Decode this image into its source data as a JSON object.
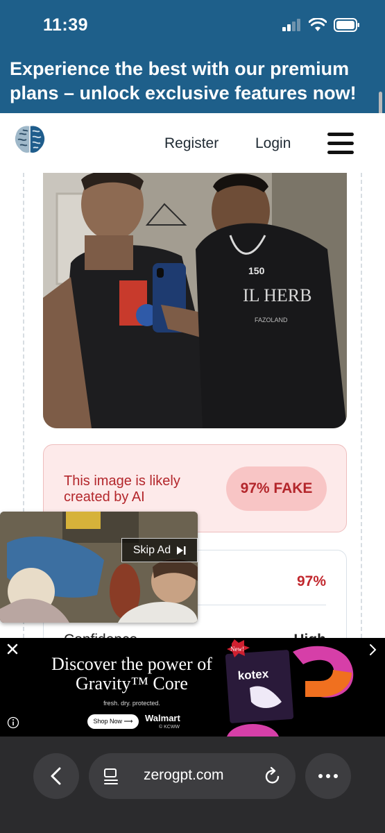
{
  "status_bar": {
    "time": "11:39"
  },
  "promo_banner": {
    "text": "Experience the best with our premium plans – unlock exclusive features now!"
  },
  "header": {
    "logo": "brain-logo-icon",
    "register": "Register",
    "login": "Login",
    "menu": "hamburger-menu-icon"
  },
  "result": {
    "message": "This image is likely created by AI",
    "badge": "97% FAKE",
    "detail_percent": "97%",
    "confidence_label": "Confidence",
    "confidence_value": "High"
  },
  "video_ad": {
    "skip_label": "Skip Ad"
  },
  "banner_ad": {
    "headline": "Discover the power of Gravity™ Core",
    "tagline": "fresh. dry. protected.",
    "button": "Shop Now ⟶",
    "retailer": "Walmart",
    "station": "© KCWW",
    "badge": "New!",
    "brand": "kotex"
  },
  "browser": {
    "url": "zerogpt.com"
  },
  "colors": {
    "banner_blue": "#1e5f8a",
    "fake_red": "#b3262b",
    "fake_bg": "#fdeaea"
  }
}
